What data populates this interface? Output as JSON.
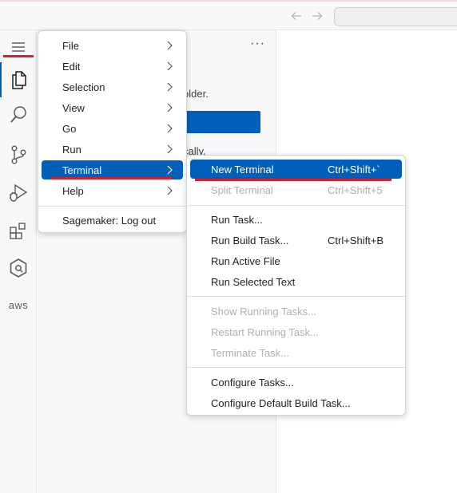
{
  "colors": {
    "accent": "#005fb8",
    "annotation_red": "#d3202f",
    "disabled_text": "#b0b0b0"
  },
  "activity_bar": {
    "items": [
      {
        "name": "explorer",
        "icon": "files-icon"
      },
      {
        "name": "search",
        "icon": "search-icon"
      },
      {
        "name": "source-control",
        "icon": "source-control-icon"
      },
      {
        "name": "run-debug",
        "icon": "run-debug-icon"
      },
      {
        "name": "extensions",
        "icon": "extensions-icon"
      },
      {
        "name": "sagemaker",
        "icon": "hexagon-icon"
      },
      {
        "name": "aws",
        "icon": "aws-icon",
        "text": "aws"
      }
    ]
  },
  "sidebar": {
    "more_label": "···",
    "text_partial_1": "older.",
    "text_partial_2": "cally."
  },
  "main_menu": {
    "items": [
      {
        "label": "File",
        "submenu": true
      },
      {
        "label": "Edit",
        "submenu": true
      },
      {
        "label": "Selection",
        "submenu": true
      },
      {
        "label": "View",
        "submenu": true
      },
      {
        "label": "Go",
        "submenu": true
      },
      {
        "label": "Run",
        "submenu": true
      },
      {
        "label": "Terminal",
        "submenu": true,
        "selected": true
      },
      {
        "label": "Help",
        "submenu": true
      }
    ],
    "logout_label": "Sagemaker: Log out"
  },
  "terminal_menu": {
    "new_terminal": {
      "label": "New Terminal",
      "shortcut": "Ctrl+Shift+`"
    },
    "split_terminal": {
      "label": "Split Terminal",
      "shortcut": "Ctrl+Shift+5"
    },
    "run_task": {
      "label": "Run Task..."
    },
    "run_build_task": {
      "label": "Run Build Task...",
      "shortcut": "Ctrl+Shift+B"
    },
    "run_active_file": {
      "label": "Run Active File"
    },
    "run_selected_text": {
      "label": "Run Selected Text"
    },
    "show_running_tasks": {
      "label": "Show Running Tasks..."
    },
    "restart_running_task": {
      "label": "Restart Running Task..."
    },
    "terminate_task": {
      "label": "Terminate Task..."
    },
    "configure_tasks": {
      "label": "Configure Tasks..."
    },
    "configure_default_build_task": {
      "label": "Configure Default Build Task..."
    }
  }
}
